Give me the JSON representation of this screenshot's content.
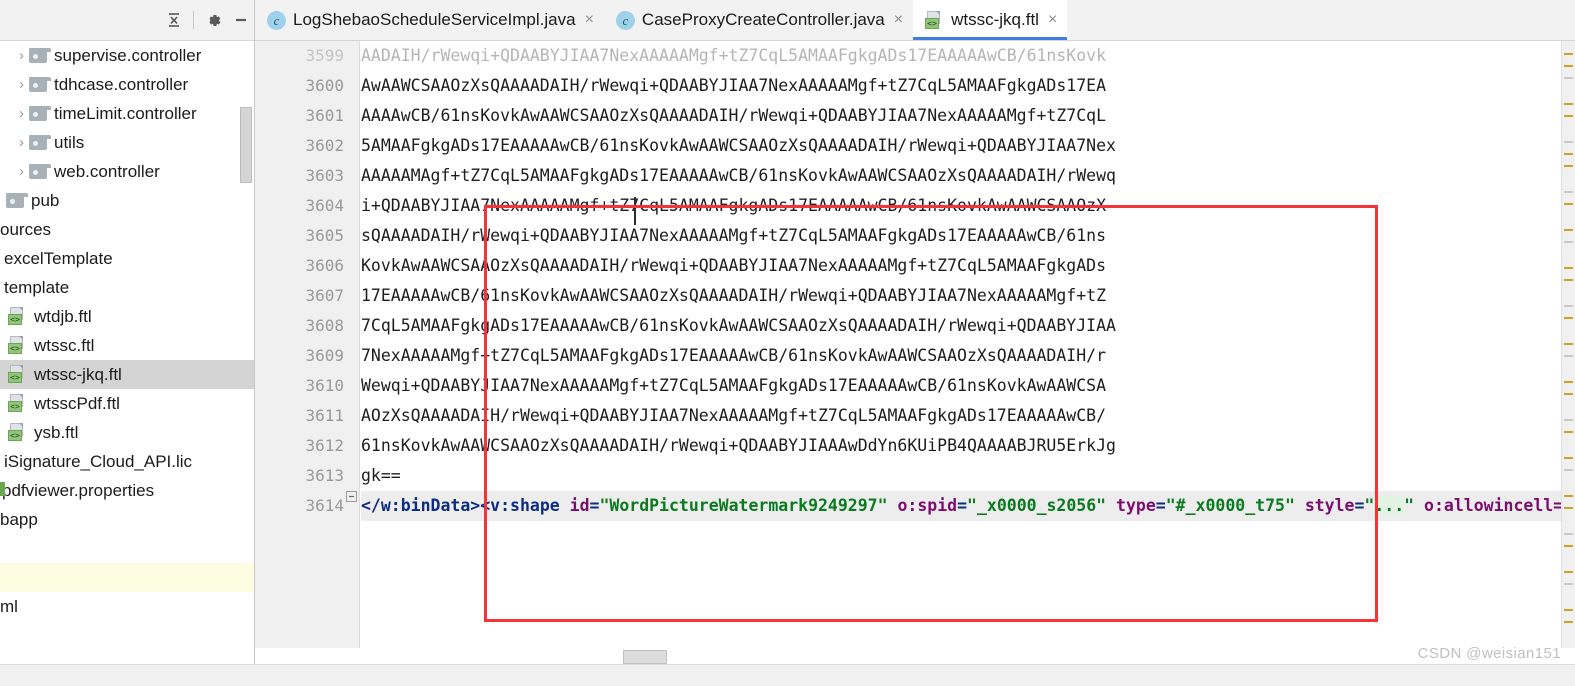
{
  "sidebar": {
    "toolbar": {
      "collapse_all_icon": "collapse-all-icon",
      "settings_icon": "gear-icon",
      "minimize_icon": "minimize-icon"
    },
    "items": [
      {
        "label": "supervise.controller",
        "icon": "folder-icon",
        "arrow": "›",
        "indent": 14,
        "type": "folder"
      },
      {
        "label": "tdhcase.controller",
        "icon": "folder-icon",
        "arrow": "›",
        "indent": 14,
        "type": "folder"
      },
      {
        "label": "timeLimit.controller",
        "icon": "folder-icon",
        "arrow": "›",
        "indent": 14,
        "type": "folder"
      },
      {
        "label": "utils",
        "icon": "folder-icon",
        "arrow": "›",
        "indent": 14,
        "type": "folder"
      },
      {
        "label": "web.controller",
        "icon": "folder-icon",
        "arrow": "›",
        "indent": 14,
        "type": "folder"
      },
      {
        "label": "pub",
        "icon": "folder-icon",
        "arrow": "",
        "indent": 6,
        "type": "folder"
      },
      {
        "label": "ources",
        "icon": "none",
        "arrow": "",
        "indent": 0,
        "type": "clipped"
      },
      {
        "label": "excelTemplate",
        "icon": "none",
        "arrow": "",
        "indent": 4,
        "type": "clipped"
      },
      {
        "label": "template",
        "icon": "none",
        "arrow": "",
        "indent": 4,
        "type": "clipped"
      },
      {
        "label": "wtdjb.ftl",
        "icon": "ftl-icon",
        "arrow": "",
        "indent": 8,
        "type": "file"
      },
      {
        "label": "wtssc.ftl",
        "icon": "ftl-icon",
        "arrow": "",
        "indent": 8,
        "type": "file"
      },
      {
        "label": "wtssc-jkq.ftl",
        "icon": "ftl-icon",
        "arrow": "",
        "indent": 8,
        "type": "file",
        "selected": true
      },
      {
        "label": "wtsscPdf.ftl",
        "icon": "ftl-icon",
        "arrow": "",
        "indent": 8,
        "type": "file"
      },
      {
        "label": "ysb.ftl",
        "icon": "ftl-icon",
        "arrow": "",
        "indent": 8,
        "type": "file"
      },
      {
        "label": "iSignature_Cloud_API.lic",
        "icon": "none",
        "arrow": "",
        "indent": 4,
        "type": "clipped"
      },
      {
        "label": "pdfviewer.properties",
        "icon": "sliver",
        "arrow": "",
        "indent": 2,
        "type": "clipped"
      },
      {
        "label": "bapp",
        "icon": "none",
        "arrow": "",
        "indent": 0,
        "type": "clipped"
      },
      {
        "label": "",
        "icon": "none",
        "arrow": "",
        "indent": 0,
        "type": "blank"
      },
      {
        "label": "",
        "icon": "none",
        "arrow": "",
        "indent": 0,
        "type": "yellowband"
      },
      {
        "label": "ml",
        "icon": "none",
        "arrow": "",
        "indent": 0,
        "type": "clipped"
      }
    ]
  },
  "tabs": [
    {
      "label": "LogShebaoScheduleServiceImpl.java",
      "icon": "java-class-icon",
      "active": false,
      "close": "×"
    },
    {
      "label": "CaseProxyCreateController.java",
      "icon": "java-class-icon",
      "active": false,
      "close": "×"
    },
    {
      "label": "wtssc-jkq.ftl",
      "icon": "ftl-icon",
      "active": true,
      "close": "×"
    }
  ],
  "editor": {
    "first_line_number": 3599,
    "lines": [
      {
        "num": "3599",
        "text": "AADAIH/rWewqi+QDAABYJIAA7NexAAAAAMgf+tZ7CqL5AMAAFgkgADs17EAAAAAwCB/61nsKovk",
        "clipped_top": true
      },
      {
        "num": "3600",
        "text": "AwAAWCSAAOzXsQAAAADAIH/rWewqi+QDAABYJIAA7NexAAAAAMgf+tZ7CqL5AMAAFgkgADs17EA"
      },
      {
        "num": "3601",
        "text": "AAAAwCB/61nsKovkAwAAWCSAAOzXsQAAAADAIH/rWewqi+QDAABYJIAA7NexAAAAAMgf+tZ7CqL"
      },
      {
        "num": "3602",
        "text": "5AMAAFgkgADs17EAAAAAwCB/61nsKovkAwAAWCSAAOzXsQAAAADAIH/rWewqi+QDAABYJIAA7Nex"
      },
      {
        "num": "3603",
        "text": "AAAAAMAgf+tZ7CqL5AMAAFgkgADs17EAAAAAwCB/61nsKovkAwAAWCSAAOzXsQAAAADAIH/rWewq"
      },
      {
        "num": "3604",
        "text": "i+QDAABYJIAA7NexAAAAAMgf+tZ7CqL5AMAAFgkgADs17EAAAAAwCB/61nsKovkAwAAWCSAAOzX"
      },
      {
        "num": "3605",
        "text": "sQAAAADAIH/rWewqi+QDAABYJIAA7NexAAAAAMgf+tZ7CqL5AMAAFgkgADs17EAAAAAwCB/61ns"
      },
      {
        "num": "3606",
        "text": "KovkAwAAWCSAAOzXsQAAAADAIH/rWewqi+QDAABYJIAA7NexAAAAAMgf+tZ7CqL5AMAAFgkgADs"
      },
      {
        "num": "3607",
        "text": "17EAAAAAwCB/61nsKovkAwAAWCSAAOzXsQAAAADAIH/rWewqi+QDAABYJIAA7NexAAAAAMgf+tZ"
      },
      {
        "num": "3608",
        "text": "7CqL5AMAAFgkgADs17EAAAAAwCB/61nsKovkAwAAWCSAAOzXsQAAAADAIH/rWewqi+QDAABYJIAA"
      },
      {
        "num": "3609",
        "text": "7NexAAAAAMgf+tZ7CqL5AMAAFgkgADs17EAAAAAwCB/61nsKovkAwAAWCSAAOzXsQAAAADAIH/r"
      },
      {
        "num": "3610",
        "text": "Wewqi+QDAABYJIAA7NexAAAAAMgf+tZ7CqL5AMAAFgkgADs17EAAAAAwCB/61nsKovkAwAAWCSA"
      },
      {
        "num": "3611",
        "text": "AOzXsQAAAADAIH/rWewqi+QDAABYJIAA7NexAAAAAMgf+tZ7CqL5AMAAFgkgADs17EAAAAAwCB/"
      },
      {
        "num": "3612",
        "text": "61nsKovkAwAAWCSAAOzXsQAAAADAIH/rWewqi+QDAABYJIAAAwDdYn6KUiPB4QAAAABJRU5ErkJg"
      },
      {
        "num": "3613",
        "text": "gk=="
      }
    ],
    "xml_line": {
      "num": "3614",
      "fold_marker": "−",
      "tokens": [
        {
          "t": "</w:binData>",
          "cls": "tag"
        },
        {
          "t": "<v:shape",
          "cls": "tag"
        },
        {
          "t": " ",
          "cls": "plain"
        },
        {
          "t": "id",
          "cls": "attr"
        },
        {
          "t": "=",
          "cls": "eq"
        },
        {
          "t": "\"WordPictureWatermark9249297\"",
          "cls": "val"
        },
        {
          "t": " ",
          "cls": "plain"
        },
        {
          "t": "o:spid",
          "cls": "attr"
        },
        {
          "t": "=",
          "cls": "eq"
        },
        {
          "t": "\"_x0000_s2056\"",
          "cls": "val"
        },
        {
          "t": " ",
          "cls": "plain"
        },
        {
          "t": "type",
          "cls": "attr"
        },
        {
          "t": "=",
          "cls": "eq"
        },
        {
          "t": "\"#_x0000_t75\"",
          "cls": "val"
        },
        {
          "t": " ",
          "cls": "plain"
        },
        {
          "t": "style",
          "cls": "attr"
        },
        {
          "t": "=",
          "cls": "eq"
        },
        {
          "t": "\"",
          "cls": "val"
        },
        {
          "t": "...",
          "cls": "val-sel"
        },
        {
          "t": "\"",
          "cls": "val"
        },
        {
          "t": " ",
          "cls": "plain"
        },
        {
          "t": "o:allowincell=",
          "cls": "attr"
        }
      ]
    }
  },
  "annotation": {
    "red_box_label": "red-highlight-rectangle",
    "color": "#f5343a"
  },
  "watermark": {
    "text": "CSDN @weisian151"
  },
  "colors": {
    "accent_tab_underline": "#3d7fe0",
    "selection_bg": "#d4d4d4",
    "gutter_bg": "#f0f0f0",
    "current_line_bg": "#ededed",
    "yellow_band": "#fcfce0"
  }
}
